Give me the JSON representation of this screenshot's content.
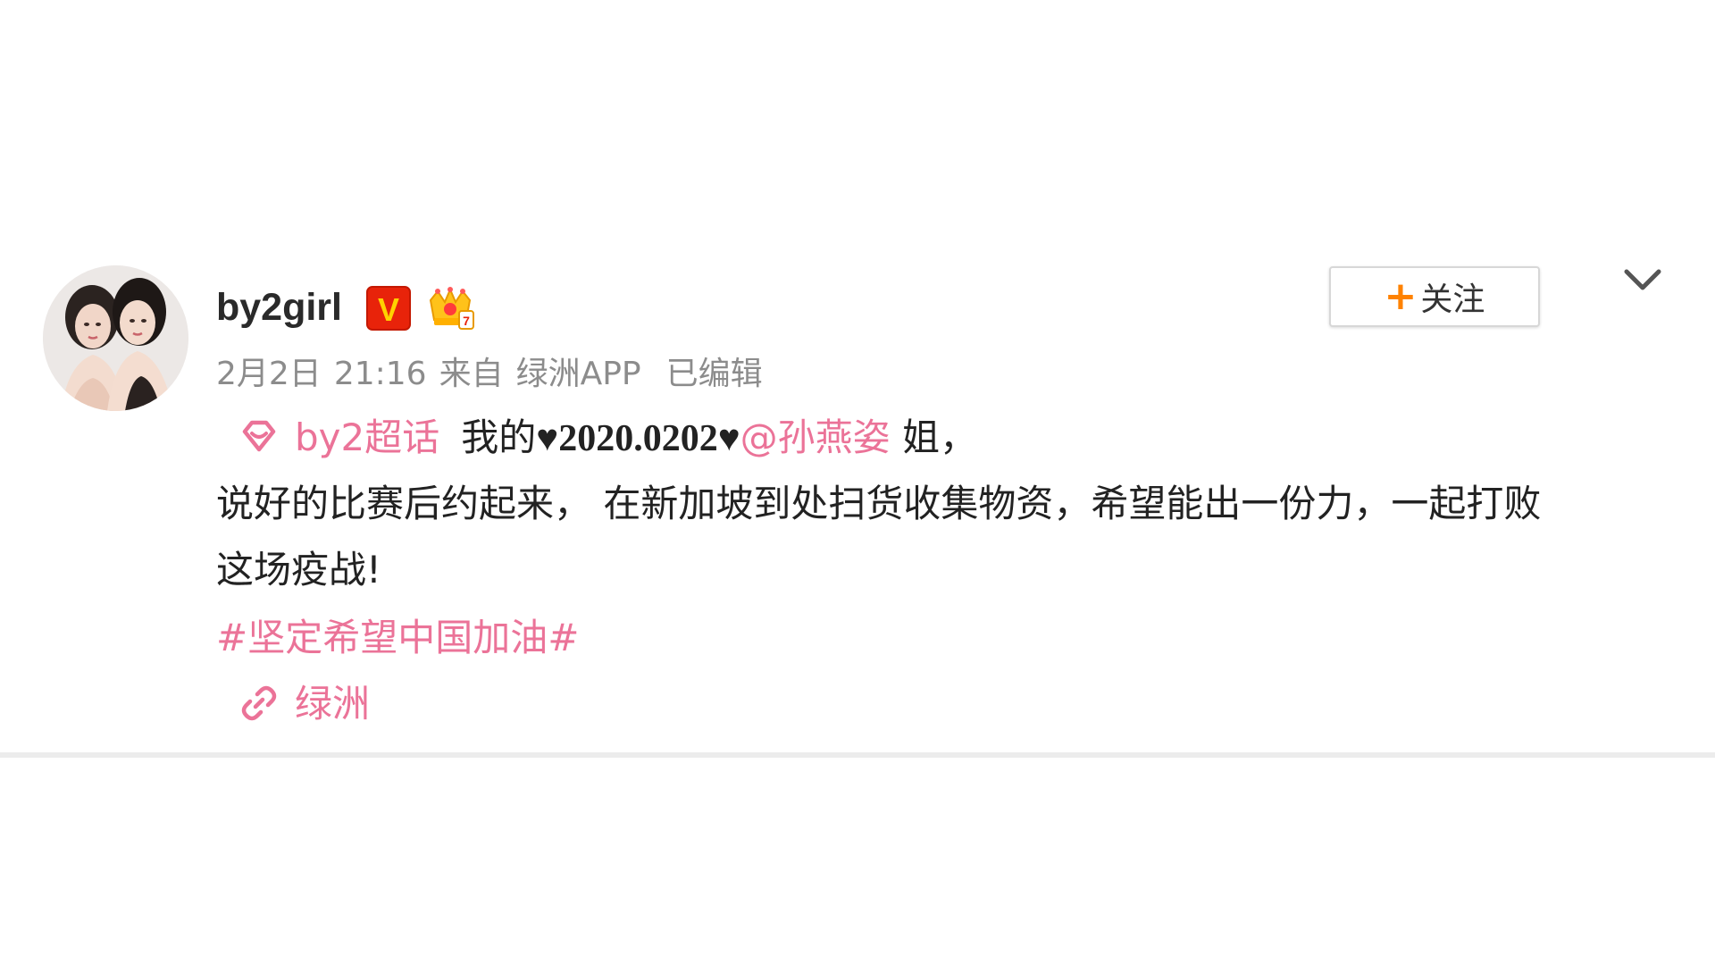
{
  "user": {
    "name": "by2girl",
    "verified_badge": "V",
    "crown_icon": "crown-icon"
  },
  "meta": {
    "date": "2月2日",
    "time": "21:16",
    "source_prefix": "来自",
    "source": "绿洲APP",
    "edited": "已编辑"
  },
  "follow_button": {
    "plus": "+",
    "label": "关注"
  },
  "post": {
    "supertopic_icon": "supertopic-diamond-icon",
    "supertopic": "by2超话",
    "text_1": "我的",
    "date_tag": "♥2020.0202♥",
    "mention": "@孙燕姿",
    "text_2": " 姐，",
    "line_2": "说好的比赛后约起来， 在新加坡到处扫货收集物资，希望能出一份力，一起打败",
    "line_3": "这场疫战!",
    "hashtag": "#坚定希望中国加油#",
    "link_icon": "link-icon",
    "link_label": "绿洲"
  },
  "colors": {
    "link_pink": "#eb7398",
    "accent_orange": "#ff8200",
    "meta_gray": "#8c8c8c",
    "badge_red": "#e8230a"
  }
}
